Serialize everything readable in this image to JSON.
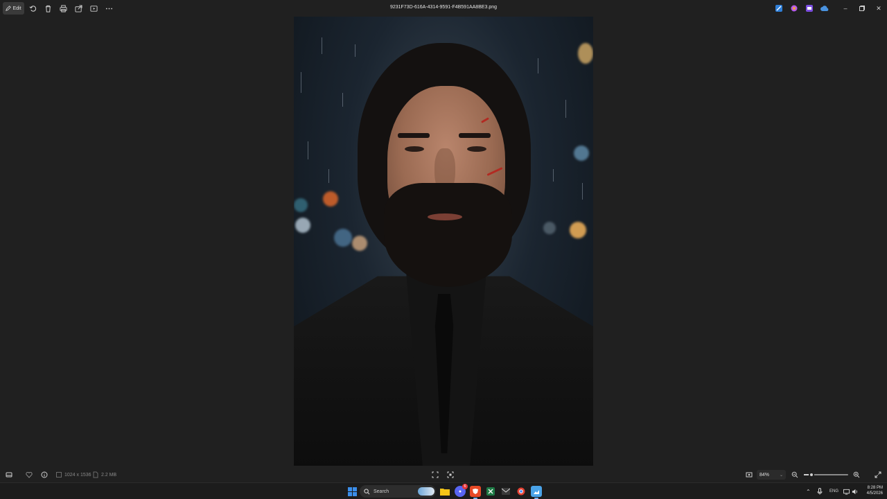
{
  "toolbar": {
    "edit_label": "Edit",
    "filename": "9231F73D-616A-4314-9591-F4B591AA8BE3.png",
    "icons": [
      "rotate-icon",
      "delete-icon",
      "print-icon",
      "share-icon",
      "slideshow-icon",
      "more-icon"
    ]
  },
  "status": {
    "dimensions": "1024 x 1536",
    "filesize": "2.2 MB",
    "zoom": "84%",
    "zoom_fraction": 0.84
  },
  "taskbar": {
    "search_placeholder": "Search",
    "language": "ENG",
    "time": "8:28 PM",
    "date": "4/5/2026",
    "discord_badge": "6",
    "colors": {
      "start": "#3b8eea",
      "explorer": "#f5c518",
      "brave": "#e84a27",
      "excel": "#1e7a45",
      "chrome": "#e34133",
      "photos": "#4aa3e8"
    }
  }
}
